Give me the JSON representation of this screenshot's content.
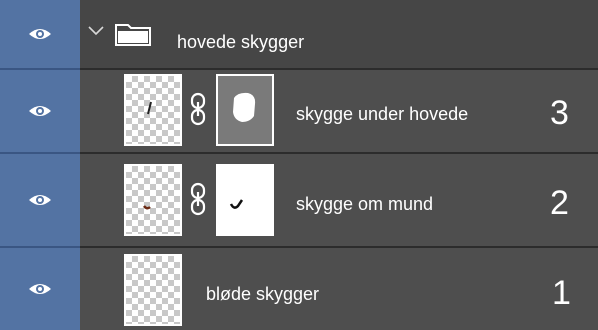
{
  "colors": {
    "eye_column": "#5373a3",
    "row_bg": "#4e4e4e",
    "group_bg": "#464646",
    "mask_gray": "#7a7a7a"
  },
  "group": {
    "name": "hovede skygger",
    "icons": [
      "eye-icon",
      "chevron-down-icon",
      "folder-icon"
    ]
  },
  "layers": [
    {
      "name": "skygge under hovede",
      "number": "3",
      "icons": [
        "eye-icon",
        "layer-thumbnail",
        "chain-link-icon",
        "mask-thumbnail"
      ]
    },
    {
      "name": "skygge om mund",
      "number": "2",
      "icons": [
        "eye-icon",
        "layer-thumbnail",
        "chain-link-icon",
        "mask-thumbnail"
      ]
    },
    {
      "name": "bløde skygger",
      "number": "1",
      "icons": [
        "eye-icon",
        "layer-thumbnail"
      ]
    }
  ]
}
